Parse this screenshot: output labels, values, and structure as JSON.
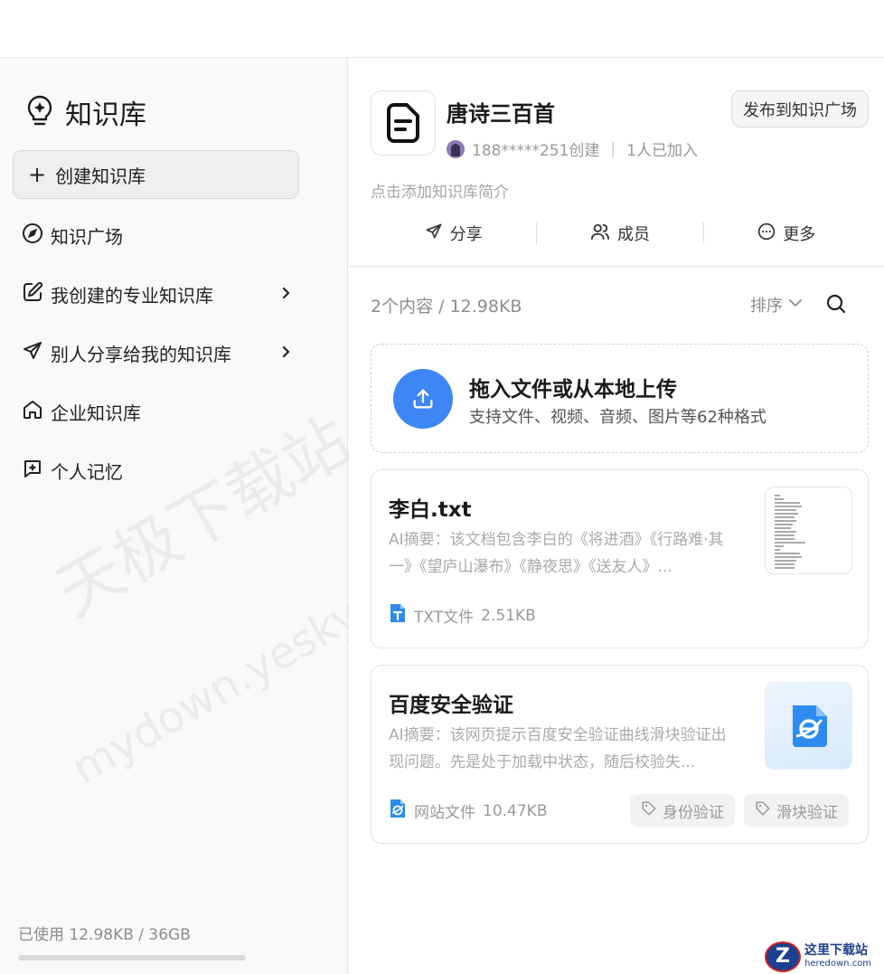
{
  "sidebar": {
    "title": "知识库",
    "create_label": "创建知识库",
    "items": [
      {
        "label": "知识广场",
        "icon": "compass-icon",
        "has_chevron": false
      },
      {
        "label": "我创建的专业知识库",
        "icon": "edit-icon",
        "has_chevron": true
      },
      {
        "label": "别人分享给我的知识库",
        "icon": "send-icon",
        "has_chevron": true
      },
      {
        "label": "企业知识库",
        "icon": "home-icon",
        "has_chevron": false
      },
      {
        "label": "个人记忆",
        "icon": "sparkle-chat-icon",
        "has_chevron": false
      }
    ],
    "usage": "已使用 12.98KB / 36GB",
    "usage_fraction": 0.0
  },
  "kb": {
    "name": "唐诗三百首",
    "creator": "188*****251创建",
    "members": "1人已加入",
    "publish_label": "发布到知识广场",
    "intro_placeholder": "点击添加知识库简介",
    "actions": {
      "share": "分享",
      "members": "成员",
      "more": "更多"
    }
  },
  "content": {
    "count": "2个内容 / 12.98KB",
    "sort_label": "排序"
  },
  "upload": {
    "title": "拖入文件或从本地上传",
    "subtitle": "支持文件、视频、音频、图片等62种格式"
  },
  "files": [
    {
      "title": "李白.txt",
      "summary": "AI摘要：该文档包含李白的《将进酒》《行路难·其一》《望庐山瀑布》《静夜思》《送友人》...",
      "type": "TXT文件",
      "size": "2.51KB",
      "tags": []
    },
    {
      "title": "百度安全验证",
      "summary": "AI摘要：该网页提示百度安全验证曲线滑块验证出现问题。先是处于加载中状态，随后校验失...",
      "type": "网站文件",
      "size": "10.47KB",
      "tags": [
        "身份验证",
        "滑块验证"
      ]
    }
  ],
  "watermark": {
    "cn": "天极下载站",
    "url": "mydown.yesky.com"
  },
  "corner_logo": {
    "cn": "这里下载站",
    "en": "heredown.com"
  },
  "colors": {
    "accent": "#3e86f6",
    "sidebar_bg": "#f9f9f9",
    "text_muted": "#999999"
  }
}
